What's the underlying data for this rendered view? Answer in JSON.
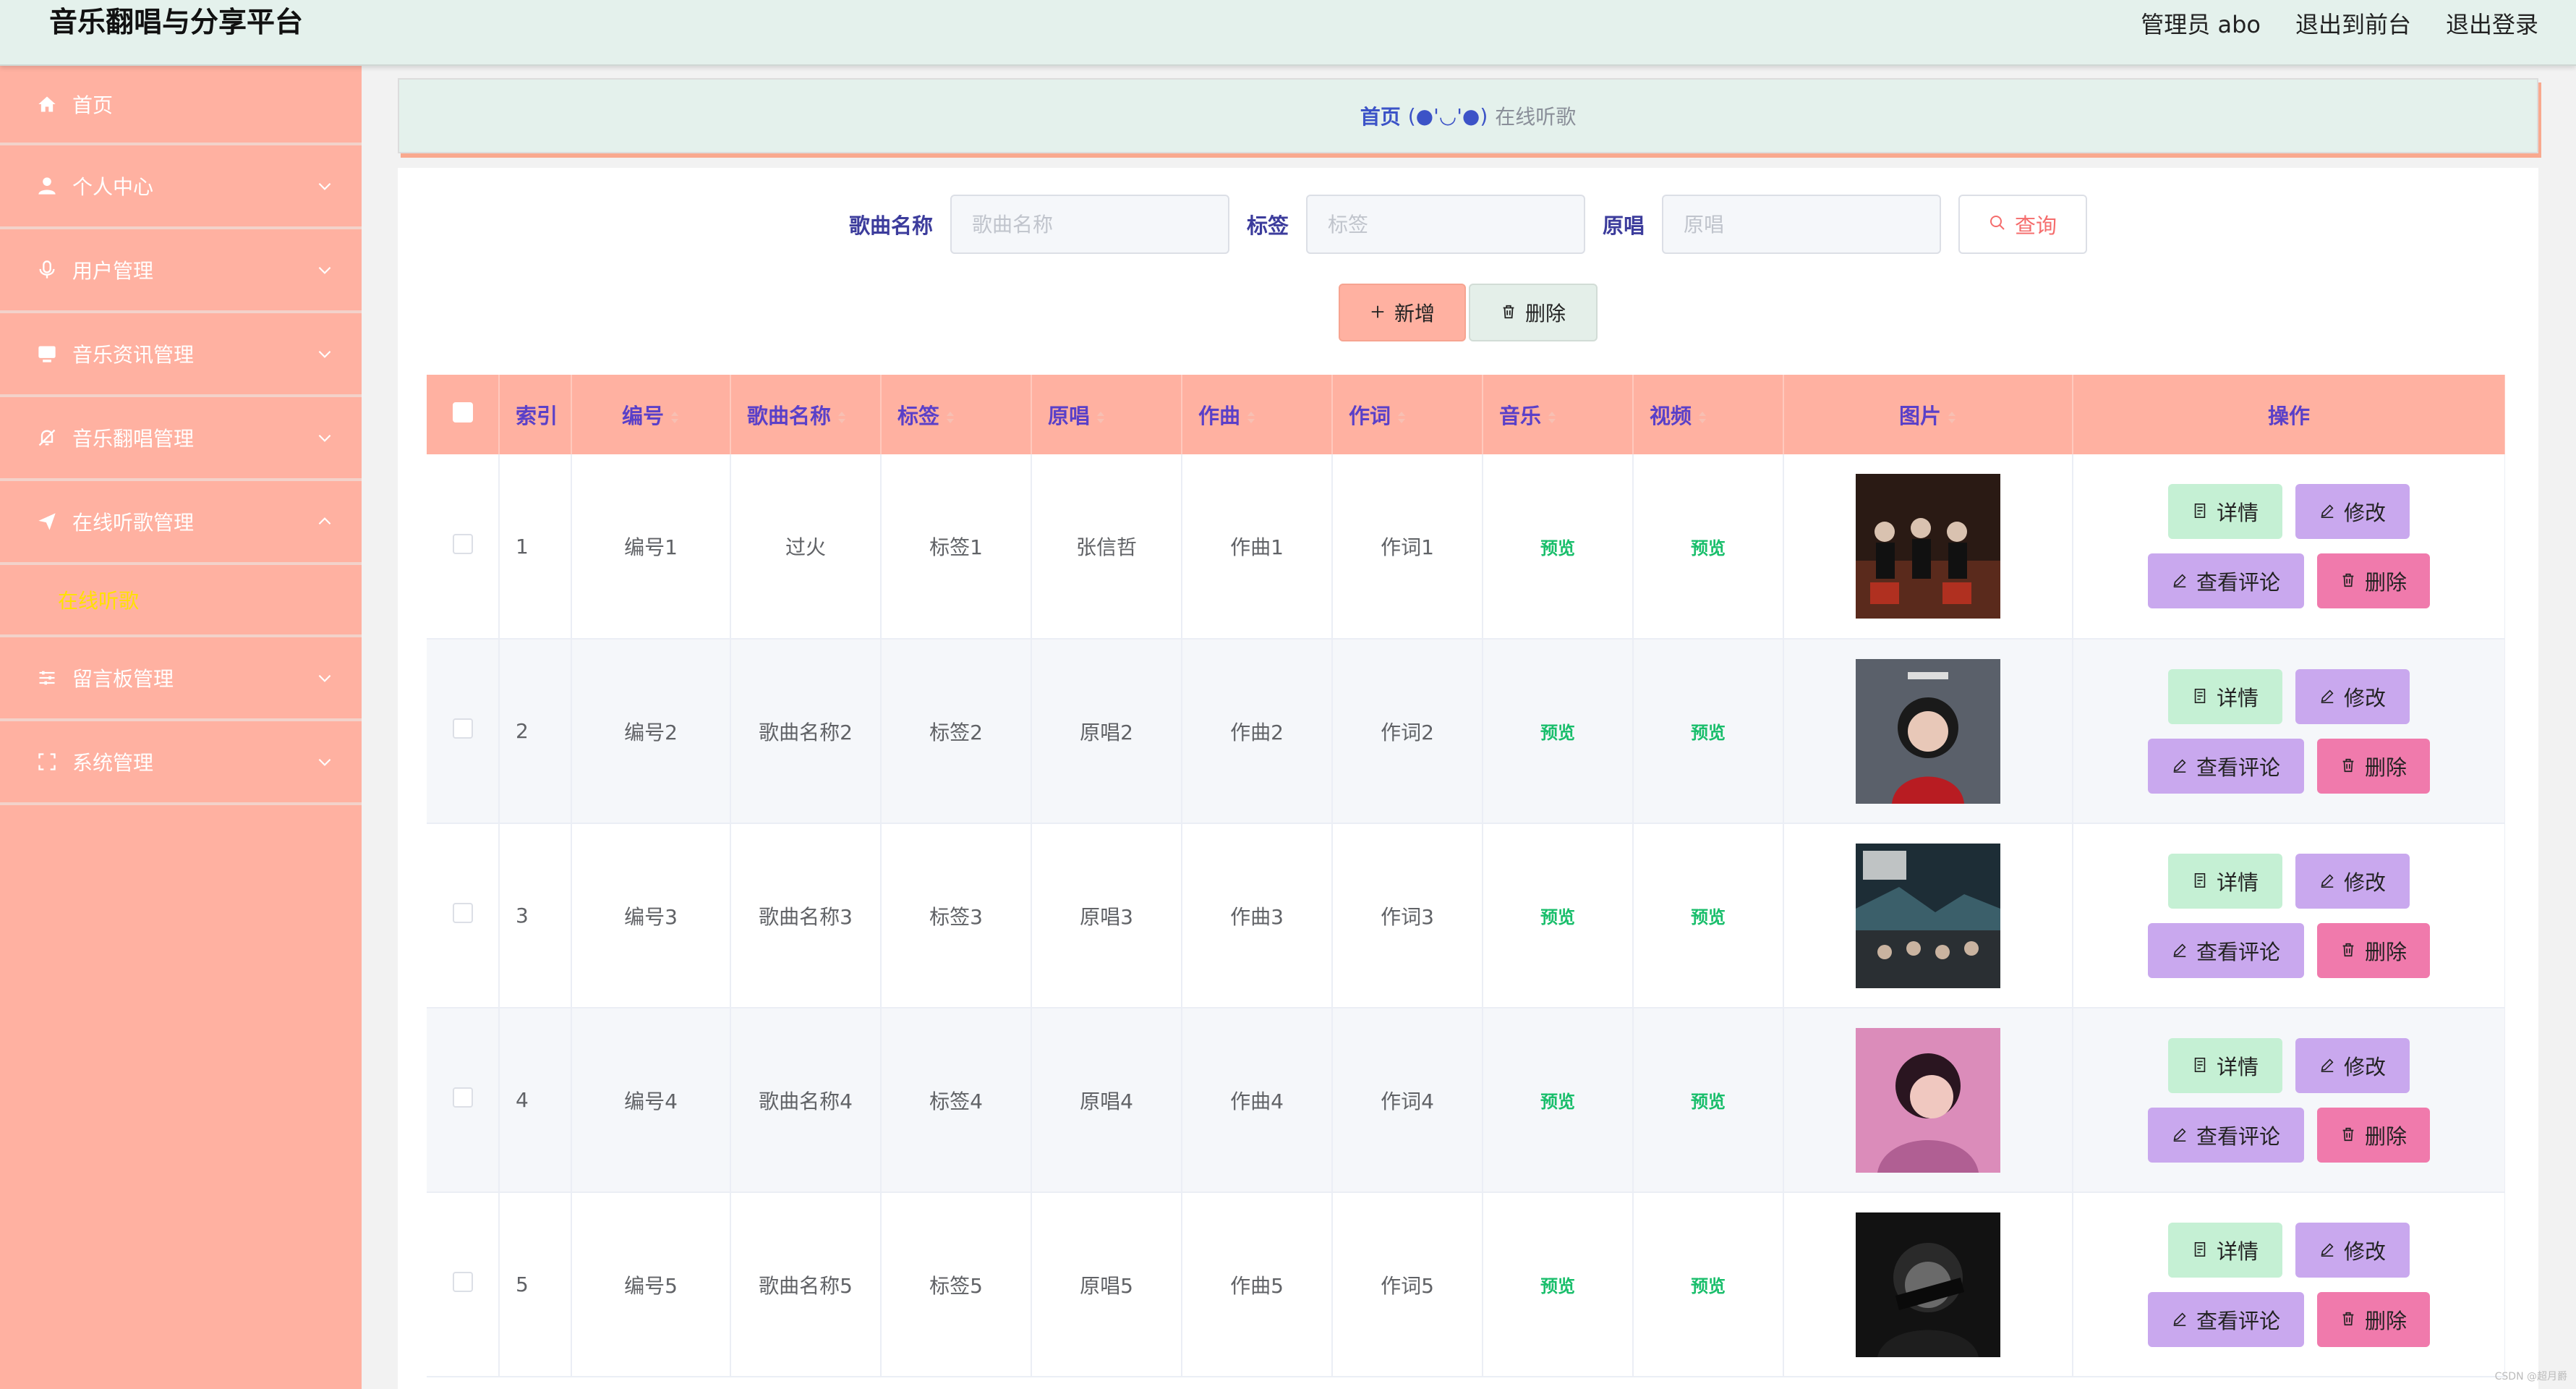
{
  "header": {
    "title": "音乐翻唱与分享平台",
    "admin_label": "管理员 abo",
    "front_link": "退出到前台",
    "logout_link": "退出登录"
  },
  "sidebar": {
    "items": [
      {
        "label": "首页",
        "icon": "home-icon"
      },
      {
        "label": "个人中心",
        "icon": "user-icon"
      },
      {
        "label": "用户管理",
        "icon": "microphone-icon"
      },
      {
        "label": "音乐资讯管理",
        "icon": "monitor-icon"
      },
      {
        "label": "音乐翻唱管理",
        "icon": "mute-bell-icon"
      },
      {
        "label": "在线听歌管理",
        "icon": "send-icon"
      },
      {
        "label": "留言板管理",
        "icon": "sliders-icon"
      },
      {
        "label": "系统管理",
        "icon": "fullscreen-icon"
      }
    ],
    "active_sub": "在线听歌"
  },
  "breadcrumb": {
    "home": "首页",
    "face": "(●'◡'●)",
    "current": "在线听歌"
  },
  "search": {
    "song_label": "歌曲名称",
    "song_placeholder": "歌曲名称",
    "tag_label": "标签",
    "tag_placeholder": "标签",
    "singer_label": "原唱",
    "singer_placeholder": "原唱",
    "query_button": "查询"
  },
  "actions": {
    "add_button": "新增",
    "delete_button": "删除"
  },
  "table": {
    "columns": [
      "索引",
      "编号",
      "歌曲名称",
      "标签",
      "原唱",
      "作曲",
      "作词",
      "音乐",
      "视频",
      "图片",
      "操作"
    ],
    "rows": [
      {
        "index": "1",
        "code": "编号1",
        "name": "过火",
        "tag": "标签1",
        "singer": "张信哲",
        "composer": "作曲1",
        "lyricist": "作词1",
        "music": "预览",
        "video": "预览"
      },
      {
        "index": "2",
        "code": "编号2",
        "name": "歌曲名称2",
        "tag": "标签2",
        "singer": "原唱2",
        "composer": "作曲2",
        "lyricist": "作词2",
        "music": "预览",
        "video": "预览"
      },
      {
        "index": "3",
        "code": "编号3",
        "name": "歌曲名称3",
        "tag": "标签3",
        "singer": "原唱3",
        "composer": "作曲3",
        "lyricist": "作词3",
        "music": "预览",
        "video": "预览"
      },
      {
        "index": "4",
        "code": "编号4",
        "name": "歌曲名称4",
        "tag": "标签4",
        "singer": "原唱4",
        "composer": "作曲4",
        "lyricist": "作词4",
        "music": "预览",
        "video": "预览"
      },
      {
        "index": "5",
        "code": "编号5",
        "name": "歌曲名称5",
        "tag": "标签5",
        "singer": "原唱5",
        "composer": "作曲5",
        "lyricist": "作词5",
        "music": "预览",
        "video": "预览"
      }
    ],
    "op_labels": {
      "detail": "详情",
      "edit": "修改",
      "comment": "查看评论",
      "delete": "删除"
    }
  },
  "watermark": "CSDN @超月爵",
  "colors": {
    "topbar": "#e4f1ec",
    "sidebar": "#ffb1a1",
    "table_header": "#ffb1a1",
    "accent_blue": "#3c53c7",
    "preview_green": "#19be6b",
    "submenu_yellow": "#ffe100"
  }
}
